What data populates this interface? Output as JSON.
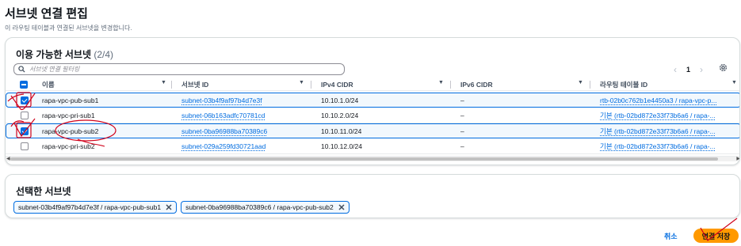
{
  "page": {
    "title": "서브넷 연결 편집",
    "subtitle": "이 라우팅 테이블과 연결된 서브넷을 변경합니다."
  },
  "available": {
    "heading": "이용 가능한 서브넷",
    "count": "(2/4)",
    "search_placeholder": "서브넷 연결 필터링",
    "page_number": "1",
    "columns": [
      "이름",
      "서브넷 ID",
      "IPv4 CIDR",
      "IPv6 CIDR",
      "라우팅 테이블 ID"
    ],
    "rows": [
      {
        "checked": true,
        "name": "rapa-vpc-pub-sub1",
        "subnet_id": "subnet-03b4f9af97b4d7e3f",
        "ipv4": "10.10.1.0/24",
        "ipv6": "–",
        "route_table": "rtb-02b0c762b1e4450a3 / rapa-vpc-p..."
      },
      {
        "checked": false,
        "name": "rapa-vpc-pri-sub1",
        "subnet_id": "subnet-06b163adfc70781cd",
        "ipv4": "10.10.2.0/24",
        "ipv6": "–",
        "route_table": "기본 (rtb-02bd872e33f73b6a6 / rapa-..."
      },
      {
        "checked": true,
        "name": "rapa-vpc-pub-sub2",
        "subnet_id": "subnet-0ba96988ba70389c6",
        "ipv4": "10.10.11.0/24",
        "ipv6": "–",
        "route_table": "기본 (rtb-02bd872e33f73b6a6 / rapa-..."
      },
      {
        "checked": false,
        "name": "rapa-vpc-pri-sub2",
        "subnet_id": "subnet-029a259fd30721aad",
        "ipv4": "10.10.12.0/24",
        "ipv6": "–",
        "route_table": "기본 (rtb-02bd872e33f73b6a6 / rapa-..."
      }
    ]
  },
  "selected": {
    "heading": "선택한 서브넷",
    "tokens": [
      "subnet-03b4f9af97b4d7e3f / rapa-vpc-pub-sub1",
      "subnet-0ba96988ba70389c6 / rapa-vpc-pub-sub2"
    ]
  },
  "footer": {
    "cancel_label": "취소",
    "save_label": "연결 저장"
  },
  "colors": {
    "link": "#006ce0",
    "primary_button": "#ff9900",
    "annotation": "#d0021b"
  },
  "icons": [
    "search-icon",
    "settings-icon",
    "close-icon",
    "chevron-left-icon",
    "chevron-right-icon",
    "sort-caret-icon"
  ]
}
